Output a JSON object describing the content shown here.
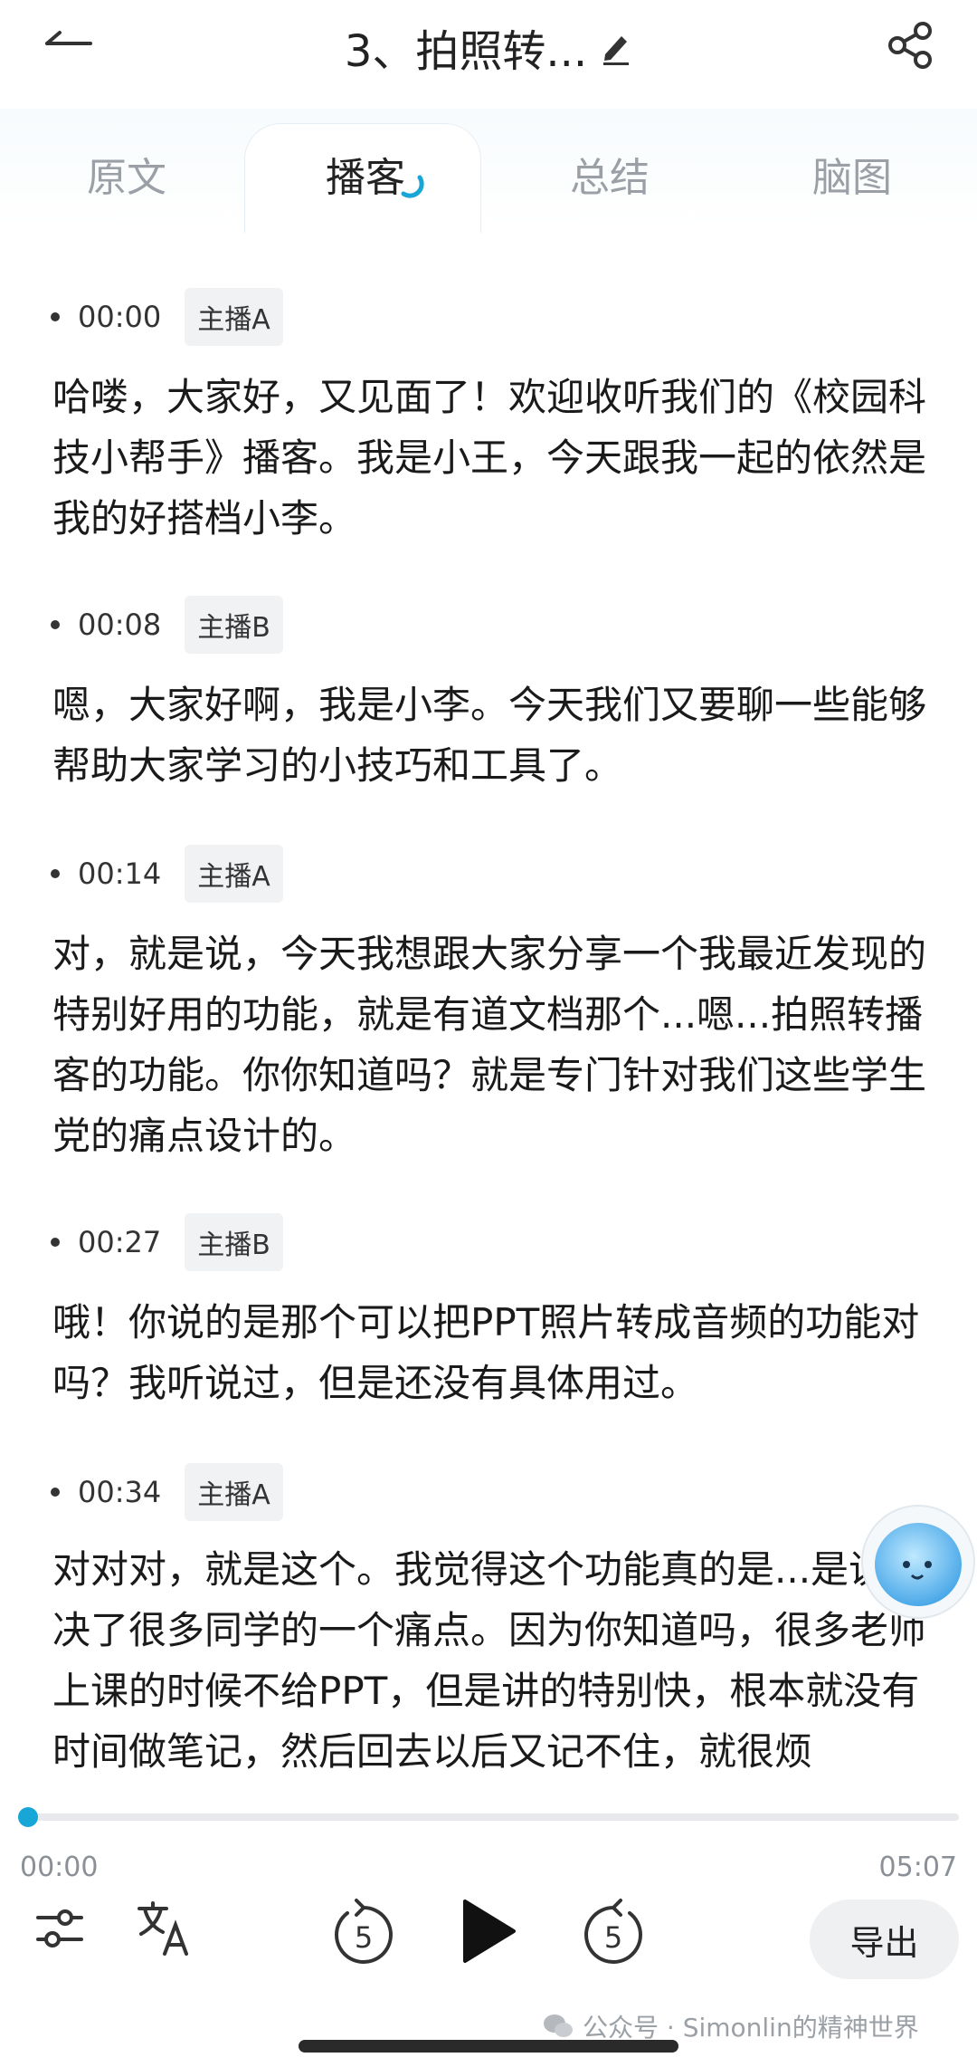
{
  "header": {
    "title": "3、拍照转...",
    "icons": [
      "back-arrow-icon",
      "edit-pencil-icon",
      "share-icon"
    ]
  },
  "tabs": [
    {
      "label": "原文",
      "active": false
    },
    {
      "label": "播客",
      "active": true
    },
    {
      "label": "总结",
      "active": false
    },
    {
      "label": "脑图",
      "active": false
    }
  ],
  "segments": [
    {
      "time": "00:00",
      "speaker": "主播A",
      "text": "哈喽，大家好，又见面了！欢迎收听我们的《校园科技小帮手》播客。我是小王，今天跟我一起的依然是我的好搭档小李。"
    },
    {
      "time": "00:08",
      "speaker": "主播B",
      "text": "嗯，大家好啊，我是小李。今天我们又要聊一些能够帮助大家学习的小技巧和工具了。"
    },
    {
      "time": "00:14",
      "speaker": "主播A",
      "text": "对，就是说，今天我想跟大家分享一个我最近发现的特别好用的功能，就是有道文档那个...嗯...拍照转播客的功能。你你知道吗？就是专门针对我们这些学生党的痛点设计的。"
    },
    {
      "time": "00:27",
      "speaker": "主播B",
      "text": "哦！你说的是那个可以把PPT照片转成音频的功能对吗？我听说过，但是还没有具体用过。"
    },
    {
      "time": "00:34",
      "speaker": "主播A",
      "text": "对对对，就是这个。我觉得这个功能真的是...是说解决了很多同学的一个痛点。因为你知道吗，很多老师上课的时候不给PPT，但是讲的特别快，根本就没有时间做笔记，然后回去以后又记不住，就很烦"
    }
  ],
  "player": {
    "current_time": "00:00",
    "total_time": "05:07",
    "progress": 0.0,
    "rewind_seconds": "5",
    "forward_seconds": "5",
    "export_label": "导出",
    "accent_color": "#18a6d6"
  },
  "watermark": {
    "text": "公众号 · Simonlin的精神世界"
  }
}
